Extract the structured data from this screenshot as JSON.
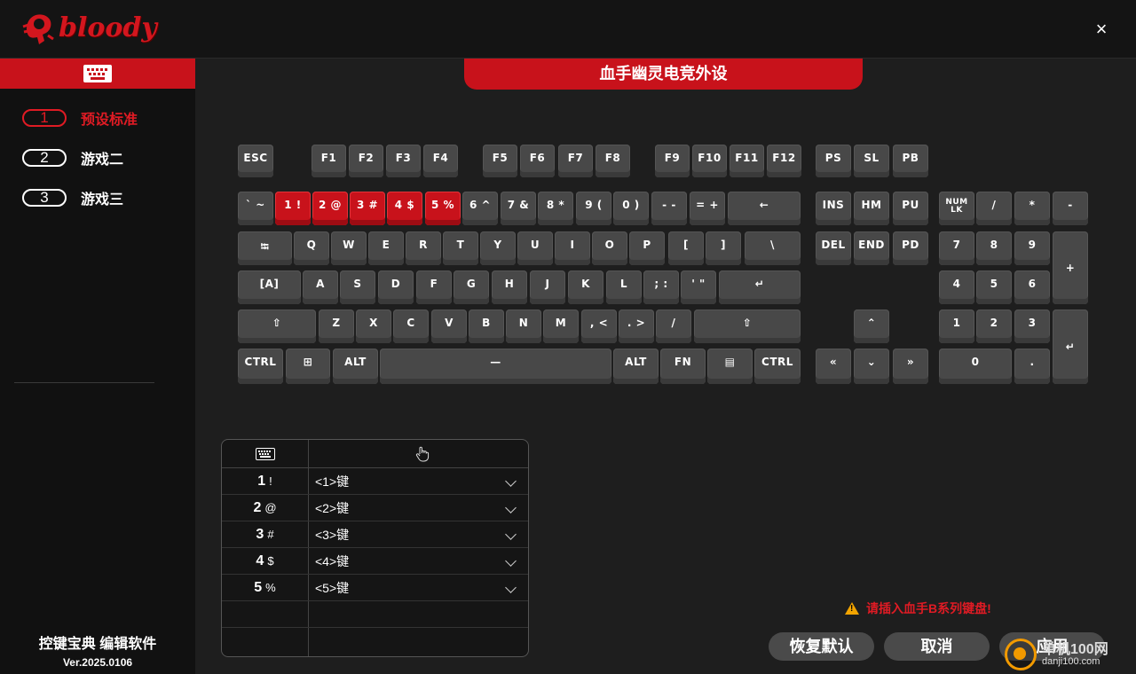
{
  "app": {
    "logo_text": "bloody",
    "close_icon": "×"
  },
  "sidebar": {
    "header_icon": "keyboard-icon",
    "profiles": [
      {
        "num": "1",
        "name": "预设标准",
        "active": true
      },
      {
        "num": "2",
        "name": "游戏二",
        "active": false
      },
      {
        "num": "3",
        "name": "游戏三",
        "active": false
      }
    ],
    "footer_title": "控键宝典 编辑软件",
    "version": "Ver.2025.0106"
  },
  "banner": {
    "title": "血手幽灵电竞外设"
  },
  "keyboard": {
    "keys": {
      "esc": "ESC",
      "f1": "F1",
      "f2": "F2",
      "f3": "F3",
      "f4": "F4",
      "f5": "F5",
      "f6": "F6",
      "f7": "F7",
      "f8": "F8",
      "f9": "F9",
      "f10": "F10",
      "f11": "F11",
      "f12": "F12",
      "ps": "PS",
      "sl": "SL",
      "pb": "PB",
      "tilde": "` ~",
      "k1": "1 !",
      "k2": "2 @",
      "k3": "3 #",
      "k4": "4 $",
      "k5": "5 %",
      "k6": "6 ^",
      "k7": "7 &",
      "k8": "8 *",
      "k9": "9 (",
      "k0": "0 )",
      "minus": "- -",
      "equal": "= +",
      "backspace": "←",
      "ins": "INS",
      "hm": "HM",
      "pu": "PU",
      "numlk": "NUM LK",
      "ndiv": "/",
      "nmul": "*",
      "nminus": "-",
      "tab": "⭾",
      "q": "Q",
      "w": "W",
      "e": "E",
      "r": "R",
      "t": "T",
      "y": "Y",
      "u": "U",
      "i": "I",
      "o": "O",
      "p": "P",
      "lbr": "[",
      "rbr": "]",
      "bslash": "\\",
      "del": "DEL",
      "end": "END",
      "pd": "PD",
      "n7": "7",
      "n8": "8",
      "n9": "9",
      "nplus": "+",
      "caps": "[A]",
      "a": "A",
      "s": "S",
      "d": "D",
      "f": "F",
      "g": "G",
      "h": "H",
      "j": "J",
      "k": "K",
      "l": "L",
      "semi": "; :",
      "quote": "' \"",
      "enter": "↵",
      "n4": "4",
      "n5": "5",
      "n6": "6",
      "lshift": "⇧",
      "z": "Z",
      "x": "X",
      "c": "C",
      "v": "V",
      "b": "B",
      "n": "N",
      "m": "M",
      "comma": ", <",
      "period": ". >",
      "slash": "/",
      "rshift": "⇧",
      "up": "⌃",
      "n1": "1",
      "n2": "2",
      "n3": "3",
      "nenter": "↵",
      "lctrl": "CTRL",
      "win": "⊞",
      "lalt": "ALT",
      "space": "—",
      "ralt": "ALT",
      "fn": "FN",
      "menu": "▤",
      "rctrl": "CTRL",
      "left": "«",
      "down": "⌄",
      "right": "»",
      "n0": "0",
      "ndot": "."
    }
  },
  "mapping": {
    "header_icon": "keyboard-icon",
    "header_right_icon": "hand-cursor-icon",
    "rows": [
      {
        "key": "1",
        "shift": "!",
        "value": "<1>键"
      },
      {
        "key": "2",
        "shift": "@",
        "value": "<2>键"
      },
      {
        "key": "3",
        "shift": "#",
        "value": "<3>键"
      },
      {
        "key": "4",
        "shift": "$",
        "value": "<4>键"
      },
      {
        "key": "5",
        "shift": "%",
        "value": "<5>键"
      },
      {
        "key": "",
        "shift": "",
        "value": ""
      },
      {
        "key": "",
        "shift": "",
        "value": ""
      }
    ]
  },
  "warning": {
    "text": "请插入血手B系列键盘!"
  },
  "buttons": {
    "restore": "恢复默认",
    "cancel": "取消",
    "apply": "应用"
  },
  "watermark": {
    "line1": "单机100网",
    "line2": "danji100.com"
  }
}
